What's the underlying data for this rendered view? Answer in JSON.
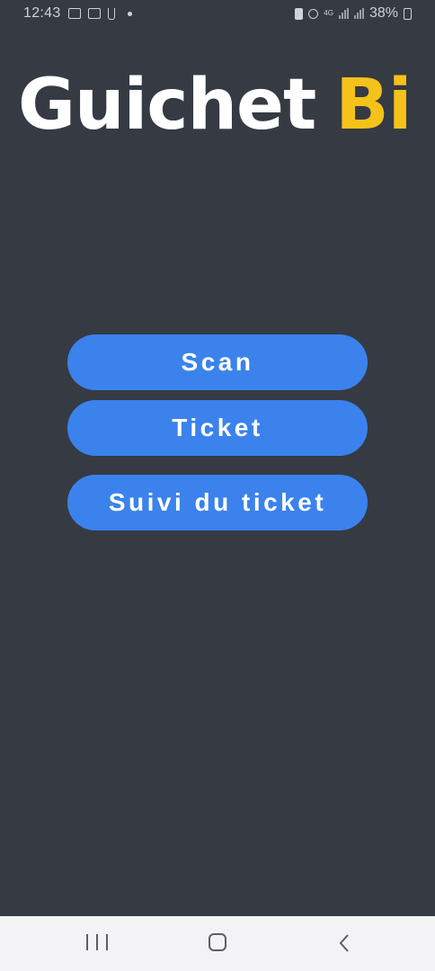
{
  "status_bar": {
    "time": "12:43",
    "network_type": "4G",
    "battery_percent": "38%",
    "icons": [
      "gallery-icon",
      "image-icon",
      "usb-icon",
      "notification-dot-icon",
      "mute-icon",
      "alarm-icon",
      "signal-icon",
      "signal-icon",
      "battery-icon"
    ]
  },
  "logo": {
    "part1": "Guichet",
    "part2": "Bi",
    "color_primary": "#ffffff",
    "color_accent": "#f5c21a"
  },
  "buttons": {
    "scan": "Scan",
    "ticket": "Ticket",
    "tracking": "Suivi du ticket"
  },
  "colors": {
    "background": "#363a43",
    "button": "#3b82ec",
    "nav_bar": "#f3f3f5"
  },
  "nav_bar": {
    "items": [
      "recents-icon",
      "home-icon",
      "back-icon"
    ]
  }
}
